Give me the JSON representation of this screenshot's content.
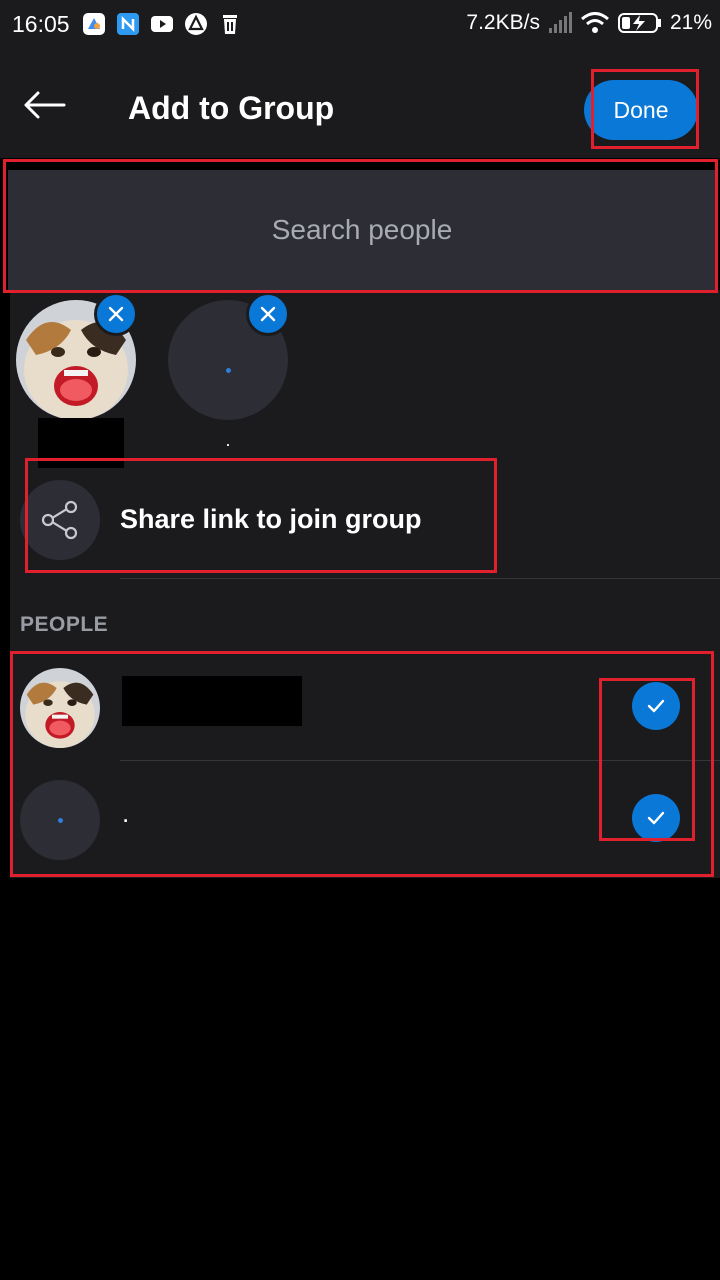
{
  "status_bar": {
    "time": "16:05",
    "net_speed": "7.2KB/s",
    "battery": "21%",
    "notification_icons": [
      "app-icon",
      "n-app-icon",
      "youtube-icon",
      "ubuntu-like-icon",
      "trash-icon"
    ]
  },
  "header": {
    "title": "Add to Group",
    "done_label": "Done"
  },
  "search": {
    "placeholder": "Search people"
  },
  "selected": [
    {
      "name": ""
    },
    {
      "name": "."
    }
  ],
  "share": {
    "label": "Share link to join group"
  },
  "people": {
    "section_label": "PEOPLE",
    "rows": [
      {
        "name": "",
        "checked": true
      },
      {
        "name": ".",
        "checked": true
      }
    ]
  },
  "colors": {
    "accent": "#0a78d7",
    "surface": "#1b1b1e",
    "input": "#2c2d35",
    "annotation": "#e0202c"
  }
}
